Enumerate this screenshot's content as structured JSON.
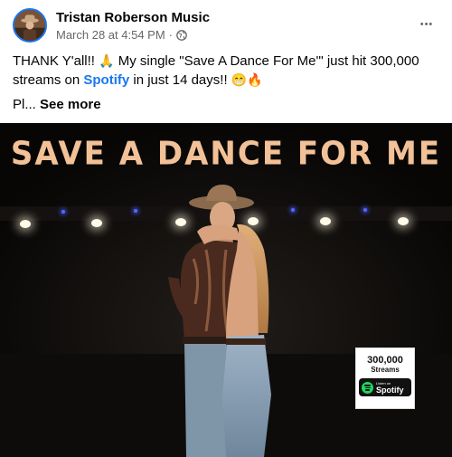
{
  "post": {
    "page_name": "Tristan Roberson Music",
    "timestamp": "March 28 at 4:54 PM",
    "separator": "·",
    "privacy_icon": "globe-icon",
    "more_icon": "more-horizontal-icon",
    "more_label": "•••",
    "text": {
      "part1": "THANK Y'all!! ",
      "emoji_pray": "🙏",
      "part2": " My single \"Save A Dance For Me'\" just hit 300,000 streams on ",
      "link": "Spotify",
      "part3": " in just 14 days!! ",
      "emoji_grin": "😁",
      "emoji_fire": "🔥"
    },
    "truncated_text": "Pl...",
    "see_more_label": "See more"
  },
  "media": {
    "title": "SAVE A DANCE FOR ME",
    "badge": {
      "count": "300,000",
      "unit": "Streams",
      "listen_label": "Listen on",
      "service": "Spotify"
    }
  },
  "colors": {
    "accent": "#1877f2",
    "title": "#f2c197",
    "spotify_green": "#1ed760",
    "muted": "#65676b"
  }
}
